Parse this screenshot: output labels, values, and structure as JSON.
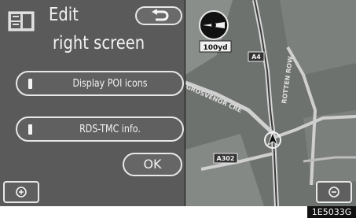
{
  "header": {
    "title_line1": "Edit",
    "title_line2": "right screen",
    "icon": "screen-split-icon"
  },
  "back_button": {
    "icon": "return-arrow-icon"
  },
  "options": [
    {
      "label": "Display POI icons",
      "indicator": "off"
    },
    {
      "label": "RDS-TMC info.",
      "indicator": "off"
    }
  ],
  "ok_button": {
    "label": "OK"
  },
  "map": {
    "compass_icon": "compass-icon",
    "scale_label": "100yd",
    "road_labels": [
      "A4",
      "A302",
      "GROSVENOR CRE",
      "ROTTEN ROW"
    ],
    "vehicle_icon": "vehicle-position-icon"
  },
  "zoom_in": {
    "icon": "zoom-in-icon"
  },
  "zoom_out": {
    "icon": "zoom-out-icon"
  },
  "image_code": "1E5033G",
  "colors": {
    "panel": "#5a5a5a",
    "button_border": "#e8e8e8",
    "map_background": "#6e726e",
    "road": "#d8d8d8"
  }
}
